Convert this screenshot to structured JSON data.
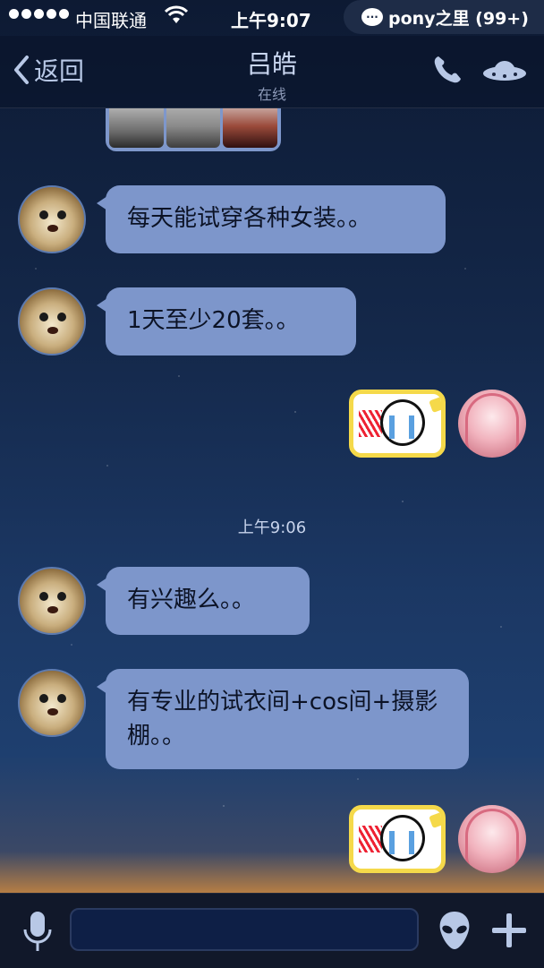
{
  "status_bar": {
    "carrier": "中国联通",
    "time": "上午9:07",
    "notification": "pony之里 (99+)"
  },
  "nav": {
    "back_label": "返回",
    "title": "吕皓",
    "subtitle": "在线"
  },
  "messages": [
    {
      "text": "每天能试穿各种女装。。"
    },
    {
      "text": "1天至少20套。。"
    },
    {
      "text": "有兴趣么。。"
    },
    {
      "text": "有专业的试衣间+cos间+摄影棚。。"
    }
  ],
  "timestamp": "上午9:06",
  "input": {
    "placeholder": ""
  },
  "icons": {
    "back": "chevron-left-icon",
    "phone": "phone-icon",
    "more": "ufo-icon",
    "mic": "microphone-icon",
    "emoji": "alien-icon",
    "add": "plus-icon"
  },
  "colors": {
    "bubble": "#7d96cb",
    "sticker_border": "#f5d94a",
    "nav_text": "#c9d6f0"
  }
}
